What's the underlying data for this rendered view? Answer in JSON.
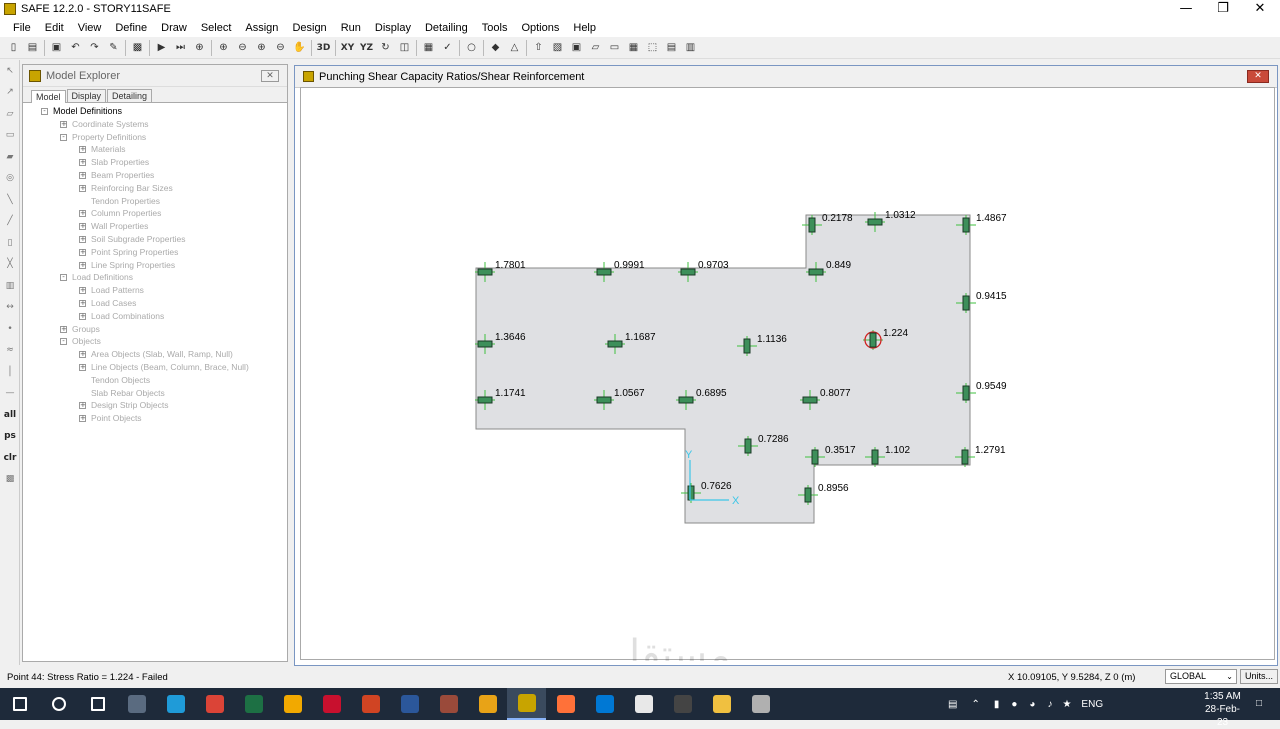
{
  "window": {
    "title": "SAFE 12.2.0 - STORY11SAFE"
  },
  "menu": [
    "File",
    "Edit",
    "View",
    "Define",
    "Draw",
    "Select",
    "Assign",
    "Design",
    "Run",
    "Display",
    "Detailing",
    "Tools",
    "Options",
    "Help"
  ],
  "toolbar": [
    "new-icon",
    "open-icon",
    "save-icon",
    "undo-icon",
    "redo-icon",
    "pencil-icon",
    "lock-icon",
    "run-icon",
    "run-all-icon",
    "zoom-window-icon",
    "zoom-in-icon",
    "zoom-out-icon",
    "zoom-extents-icon",
    "zoom-previous-icon",
    "pan-icon",
    "3D",
    "XY",
    "YZ",
    "rotate-icon",
    "view-icon",
    "object-shrink-icon",
    "check-icon",
    "circle-icon",
    "fill-icon",
    "triangle-icon",
    "up-arrow-icon",
    "display-icon",
    "image-icon",
    "slab-icon",
    "beam-icon",
    "grid-icon",
    "select-box-icon",
    "table-icon",
    "table2-icon"
  ],
  "left_tools": [
    "pointer-icon",
    "reshape-icon",
    "area-icon",
    "rectangle-icon",
    "quad-icon",
    "circle-area-icon",
    "line-icon",
    "beam-draw-icon",
    "column-icon",
    "brace-icon",
    "wall-icon",
    "dimension-icon",
    "point-icon",
    "snap-icon",
    "ruler-icon",
    "grid-snap-icon",
    "all",
    "ps",
    "clr",
    "select-intersect-icon"
  ],
  "explorer": {
    "title": "Model Explorer",
    "tabs": [
      "Model",
      "Display",
      "Detailing"
    ],
    "tree": [
      {
        "label": "Model Definitions",
        "level": 0,
        "sign": "-",
        "root": true
      },
      {
        "label": "Coordinate Systems",
        "level": 1,
        "sign": "+"
      },
      {
        "label": "Property Definitions",
        "level": 1,
        "sign": "-"
      },
      {
        "label": "Materials",
        "level": 2,
        "sign": "+"
      },
      {
        "label": "Slab Properties",
        "level": 2,
        "sign": "+"
      },
      {
        "label": "Beam Properties",
        "level": 2,
        "sign": "+"
      },
      {
        "label": "Reinforcing Bar Sizes",
        "level": 2,
        "sign": "+"
      },
      {
        "label": "Tendon Properties",
        "level": 2,
        "sign": ""
      },
      {
        "label": "Column Properties",
        "level": 2,
        "sign": "+"
      },
      {
        "label": "Wall Properties",
        "level": 2,
        "sign": "+"
      },
      {
        "label": "Soil Subgrade Properties",
        "level": 2,
        "sign": "+"
      },
      {
        "label": "Point Spring Properties",
        "level": 2,
        "sign": "+"
      },
      {
        "label": "Line Spring Properties",
        "level": 2,
        "sign": "+"
      },
      {
        "label": "Load Definitions",
        "level": 1,
        "sign": "-"
      },
      {
        "label": "Load Patterns",
        "level": 2,
        "sign": "+"
      },
      {
        "label": "Load Cases",
        "level": 2,
        "sign": "+"
      },
      {
        "label": "Load Combinations",
        "level": 2,
        "sign": "+"
      },
      {
        "label": "Groups",
        "level": 1,
        "sign": "+"
      },
      {
        "label": "Objects",
        "level": 1,
        "sign": "-"
      },
      {
        "label": "Area Objects (Slab, Wall, Ramp, Null)",
        "level": 2,
        "sign": "+"
      },
      {
        "label": "Line Objects (Beam, Column, Brace, Null)",
        "level": 2,
        "sign": "+"
      },
      {
        "label": "Tendon Objects",
        "level": 2,
        "sign": ""
      },
      {
        "label": "Slab Rebar Objects",
        "level": 2,
        "sign": ""
      },
      {
        "label": "Design Strip Objects",
        "level": 2,
        "sign": "+"
      },
      {
        "label": "Point Objects",
        "level": 2,
        "sign": "+"
      }
    ]
  },
  "view": {
    "title": "Punching Shear Capacity Ratios/Shear Reinforcement",
    "axis_x": "X",
    "axis_y": "Y",
    "ratios": [
      {
        "value": "0.2178",
        "orient": "v"
      },
      {
        "value": "1.0312",
        "orient": "h"
      },
      {
        "value": "1.4867",
        "orient": "v"
      },
      {
        "value": "1.7801",
        "orient": "h"
      },
      {
        "value": "0.9991",
        "orient": "h"
      },
      {
        "value": "0.9703",
        "orient": "h"
      },
      {
        "value": "0.849",
        "orient": "h"
      },
      {
        "value": "0.9415",
        "orient": "v"
      },
      {
        "value": "1.3646",
        "orient": "h"
      },
      {
        "value": "1.1687",
        "orient": "h"
      },
      {
        "value": "1.1136",
        "orient": "v"
      },
      {
        "value": "1.224",
        "orient": "v",
        "failed": true
      },
      {
        "value": "1.1741",
        "orient": "h"
      },
      {
        "value": "1.0567",
        "orient": "h"
      },
      {
        "value": "0.6895",
        "orient": "h"
      },
      {
        "value": "0.8077",
        "orient": "h"
      },
      {
        "value": "0.9549",
        "orient": "v"
      },
      {
        "value": "0.7286",
        "orient": "v"
      },
      {
        "value": "0.3517",
        "orient": "v"
      },
      {
        "value": "1.102",
        "orient": "v"
      },
      {
        "value": "1.2791",
        "orient": "v"
      },
      {
        "value": "0.7626",
        "orient": "v"
      },
      {
        "value": "0.8956",
        "orient": "v"
      }
    ]
  },
  "status": {
    "message": "Point 44:  Stress Ratio = 1.224  - Failed",
    "coords": "X 10.09105,  Y 9.5284,  Z 0   (m)",
    "coord_system": "GLOBAL",
    "units_button": "Units..."
  },
  "taskbar": {
    "apps": [
      {
        "name": "start-icon",
        "color": "#ffffff"
      },
      {
        "name": "search-icon",
        "color": "#ffffff"
      },
      {
        "name": "task-view-icon",
        "color": "#ffffff"
      },
      {
        "name": "camera-app-icon",
        "color": "#5a6b80"
      },
      {
        "name": "edge-icon",
        "color": "#1f9bd8"
      },
      {
        "name": "chrome-icon",
        "color": "#db4437"
      },
      {
        "name": "excel-icon",
        "color": "#1d7044"
      },
      {
        "name": "store-icon",
        "color": "#f2a900"
      },
      {
        "name": "autocad-icon",
        "color": "#c8102e"
      },
      {
        "name": "powerpoint-icon",
        "color": "#d04423"
      },
      {
        "name": "word-icon",
        "color": "#2b579a"
      },
      {
        "name": "etabs-icon",
        "color": "#9a4a3a"
      },
      {
        "name": "app-icon",
        "color": "#e8a317"
      },
      {
        "name": "safe-icon",
        "color": "#c8a400",
        "active": true
      },
      {
        "name": "firefox-icon",
        "color": "#ff7139"
      },
      {
        "name": "outlook-icon",
        "color": "#0078d4"
      },
      {
        "name": "app2-icon",
        "color": "#e8e8e8"
      },
      {
        "name": "app3-icon",
        "color": "#444444"
      },
      {
        "name": "explorer-icon",
        "color": "#f0c040"
      },
      {
        "name": "app4-icon",
        "color": "#b0b0b0"
      }
    ],
    "lang": "ENG",
    "time": "1:35 AM",
    "date": "28-Feb-23"
  },
  "watermark": {
    "arabic": "مستقل",
    "latin": "mostaql.com"
  }
}
